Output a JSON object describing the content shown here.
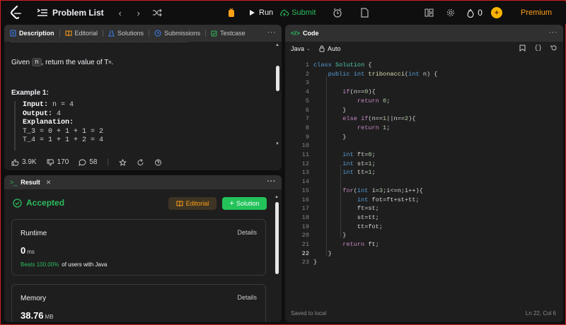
{
  "topbar": {
    "title": "Problem List",
    "prev": "‹",
    "next": "›",
    "run_label": "Run",
    "submit_label": "Submit",
    "streak_count": "0",
    "premium_label": "Premium"
  },
  "description": {
    "tabs": [
      {
        "label": "Description",
        "icon": "description-icon"
      },
      {
        "label": "Editorial",
        "icon": "book-icon"
      },
      {
        "label": "Solutions",
        "icon": "flask-icon"
      },
      {
        "label": "Submissions",
        "icon": "history-icon"
      },
      {
        "label": "Testcase",
        "icon": "checkbox-icon"
      }
    ],
    "given_pre": "Given",
    "given_var": "n",
    "given_post": ", return the value of T",
    "given_sub": "n",
    "given_end": ".",
    "example_title": "Example 1:",
    "input_label": "Input:",
    "input_value": " n = 4",
    "output_label": "Output:",
    "output_value": " 4",
    "explanation_label": "Explanation:",
    "line1": "T_3 = 0 + 1 + 1 = 2",
    "line2": "T_4 = 1 + 1 + 2 = 4",
    "likes": "3.9K",
    "dislikes": "170",
    "comments": "58"
  },
  "result": {
    "tab_label": "Result",
    "status": "Accepted",
    "editorial_btn": "Editorial",
    "solution_btn": "Solution",
    "runtime_title": "Runtime",
    "runtime_details": "Details",
    "runtime_value": "0",
    "runtime_unit": "ms",
    "beats_pct": "Beats 100.00%",
    "beats_text": "of users with Java",
    "memory_title": "Memory",
    "memory_details": "Details",
    "memory_value": "38.76",
    "memory_unit": "MB"
  },
  "code": {
    "tab_label": "Code",
    "language": "Java",
    "auto_label": "Auto",
    "saved_status": "Saved to local",
    "cursor_pos": "Ln 22, Col 6"
  },
  "colors": {
    "accent_green": "#2cbb5d",
    "accent_orange": "#ffa116",
    "panel_bg": "#1e1e1e",
    "tab_bg": "#303030"
  }
}
